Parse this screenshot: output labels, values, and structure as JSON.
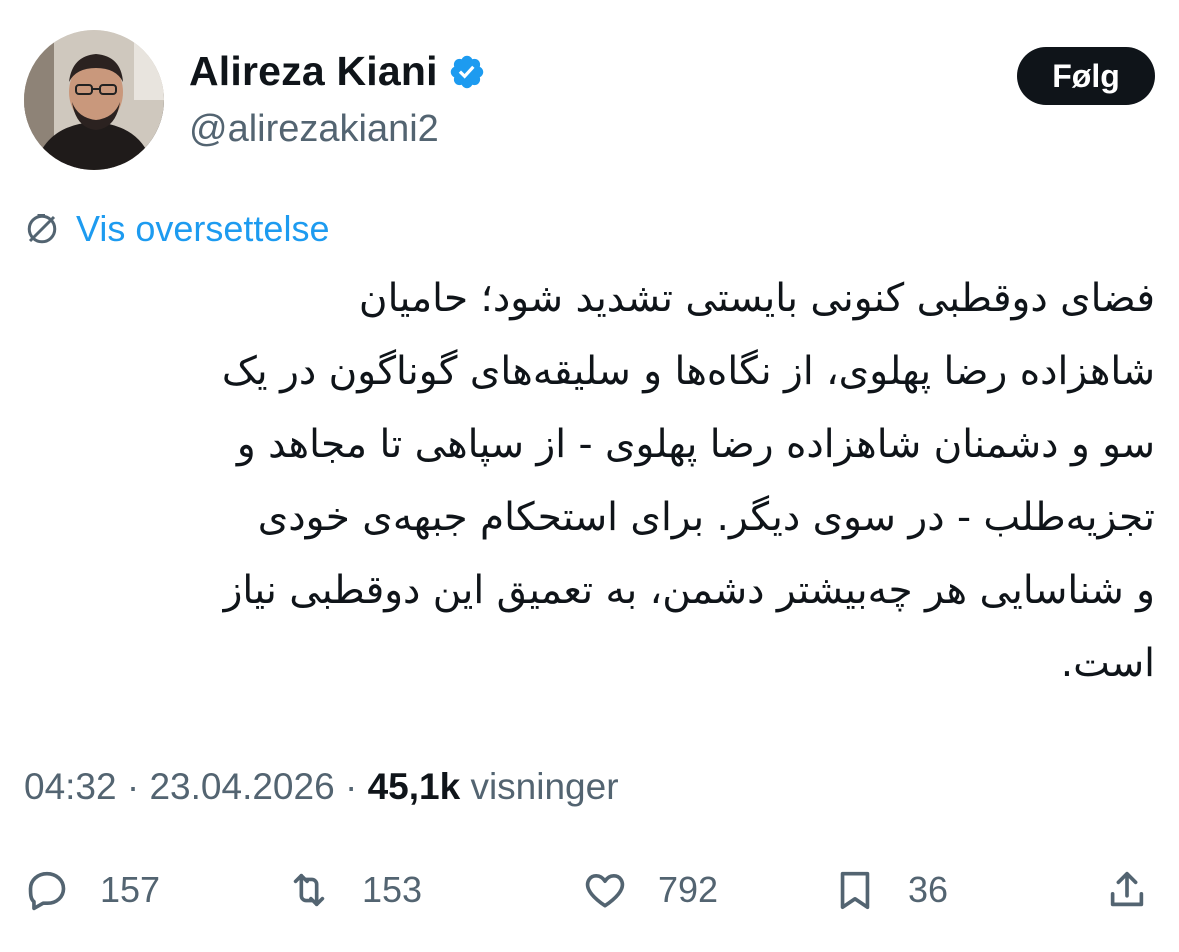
{
  "author": {
    "name": "Alireza Kiani",
    "handle": "@alirezakiani2",
    "verified": true
  },
  "follow_label": "Følg",
  "translate_label": "Vis oversettelse",
  "tweet_lines": [
    "فضای دوقطبی کنونی بایستی تشدید شود؛ حامیان",
    "شاهزاده رضا پهلوی، از نگاه‌ها و سلیقه‌های گوناگون در یک",
    "سو و دشمنان شاهزاده رضا پهلوی - از سپاهی تا مجاهد و",
    "تجزیه‌طلب - در سوی دیگر. برای استحکام جبهه‌ی خودی",
    "و شناسایی هر چه‌بیشتر دشمن، به تعمیق این دوقطبی نیاز",
    "است."
  ],
  "meta": {
    "time": "04:32",
    "date": "23.04.2026",
    "views": "45,1k",
    "views_label": "visninger",
    "separator": "·"
  },
  "actions": {
    "replies": "157",
    "reposts": "153",
    "likes": "792",
    "bookmarks": "36"
  },
  "colors": {
    "text": "#0f1419",
    "secondary": "#536471",
    "accent": "#1d9bf0",
    "button": "#0f1419"
  },
  "icons": [
    "verified-badge-icon",
    "translate-icon",
    "reply-icon",
    "repost-icon",
    "like-icon",
    "bookmark-icon",
    "share-icon"
  ]
}
